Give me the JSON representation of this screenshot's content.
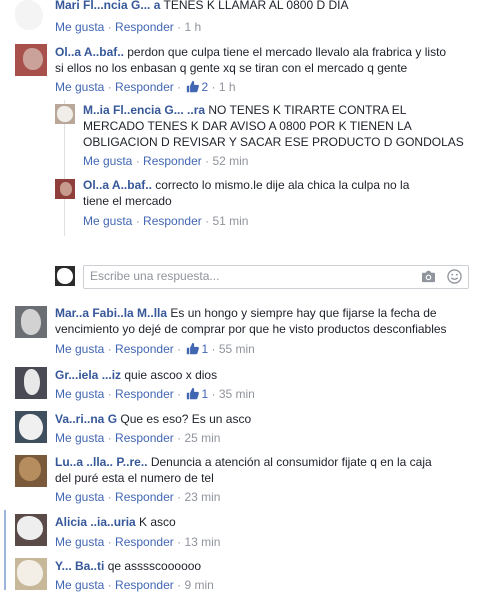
{
  "actions": {
    "like_label": "Me gusta",
    "reply_label": "Responder",
    "separator": "·"
  },
  "comments": [
    {
      "author": "Mari Fl...ncia G... a",
      "text": "TENES K LLAMAR AL 0800 D DIA",
      "time": "1 h",
      "likes": ""
    },
    {
      "author": "Ol..a A..baf.. ",
      "text_lines": [
        "perdon que culpa tiene el mercado llevalo ala frabrica y listo",
        "si ellos no los enbasan q gente xq se tiran con el mercado q gente"
      ],
      "time": "1 h",
      "likes": "2"
    },
    {
      "author": "M..ia Fl..encia G... ..ra",
      "text_lines": [
        "NO TENES K TIRARTE CONTRA EL",
        "MERCADO TENES K DAR AVISO A 0800 POR K TIENEN LA",
        "OBLIGACION D REVISAR Y SACAR ESE PRODUCTO D GONDOLAS"
      ],
      "time": "52 min",
      "likes": ""
    },
    {
      "author": "Ol..a A..baf..",
      "text_lines": [
        "correcto lo mismo.le dije ala chica la culpa no la",
        "tiene el mercado"
      ],
      "time": "51 min",
      "likes": ""
    },
    {
      "author": "Mar..a Fabi..la M..lla",
      "text_lines": [
        "Es un hongo y siempre hay que fijarse la fecha de",
        "vencimiento yo dejé de comprar por que he visto productos desconfiables"
      ],
      "time": "55 min",
      "likes": "1"
    },
    {
      "author": "Gr...iela ...iz",
      "text": "quie ascoo x dios",
      "time": "35 min",
      "likes": "1"
    },
    {
      "author": "Va..ri..na G",
      "text": "Que es eso? Es un asco",
      "time": "25 min",
      "likes": ""
    },
    {
      "author": "Lu..a ..lla.. P..re..",
      "text_lines": [
        "Denuncia a atención al consumidor fijate q en la caja",
        "del puré esta el numero de tel"
      ],
      "time": "23 min",
      "likes": ""
    },
    {
      "author": "Alicia ..ia..uria",
      "text": "K asco",
      "time": "13 min",
      "likes": ""
    },
    {
      "author": "Y... Ba..ti",
      "text": "qe asssscoooooo",
      "time": "9 min",
      "likes": ""
    }
  ],
  "reply_input": {
    "placeholder": "Escribe una respuesta..."
  },
  "icons": {
    "like": "thumbs-up-icon",
    "camera": "camera-icon",
    "emoji": "smiley-icon"
  },
  "colors": {
    "link": "#4267b2",
    "name": "#365899",
    "meta": "#90949c",
    "text": "#1d2129"
  }
}
